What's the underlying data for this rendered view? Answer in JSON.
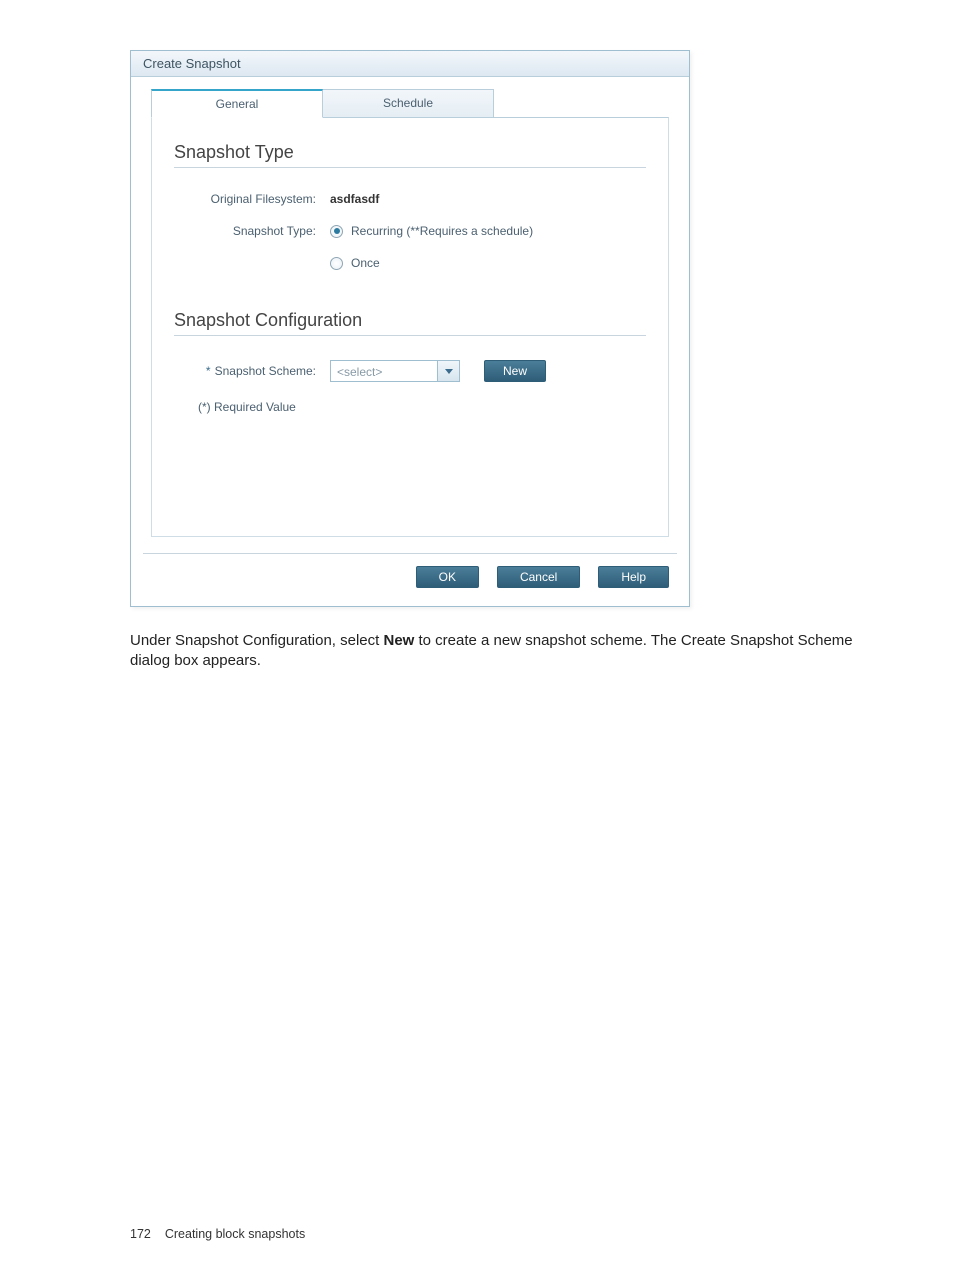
{
  "dialog": {
    "title": "Create Snapshot",
    "tabs": {
      "general": "General",
      "schedule": "Schedule"
    },
    "type_section": {
      "heading": "Snapshot Type",
      "orig_fs_label": "Original Filesystem:",
      "orig_fs_value": "asdfasdf",
      "snap_type_label": "Snapshot Type:",
      "recurring_label": "Recurring (**Requires a schedule)",
      "once_label": "Once"
    },
    "config_section": {
      "heading": "Snapshot Configuration",
      "scheme_label_star": "*",
      "scheme_label": "Snapshot Scheme:",
      "select_placeholder": "<select>",
      "new_button": "New",
      "required_note": "(*) Required Value"
    },
    "footer": {
      "ok": "OK",
      "cancel": "Cancel",
      "help": "Help"
    }
  },
  "body_text": {
    "line": "Under Snapshot Configuration, select ",
    "bold": "New",
    "rest": " to create a new snapshot scheme. The Create Snapshot Scheme dialog box appears."
  },
  "page_footer": {
    "number": "172",
    "title": "Creating block snapshots"
  }
}
